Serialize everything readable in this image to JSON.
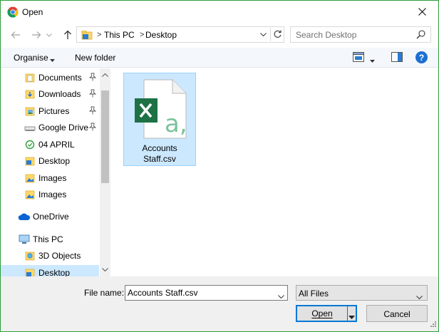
{
  "window": {
    "title": "Open",
    "app_icon": "chrome-icon",
    "close_icon": "close-icon"
  },
  "address": {
    "path": [
      "This PC",
      "Desktop"
    ],
    "separator": ">",
    "folder_icon": "folder-icon",
    "dropdown_icon": "chevron-down-icon",
    "refresh_icon": "refresh-icon"
  },
  "nav_buttons": {
    "back": "back-arrow-icon",
    "forward": "forward-arrow-icon",
    "recent": "chevron-down-icon",
    "up": "up-arrow-icon"
  },
  "search": {
    "placeholder": "Search Desktop",
    "icon": "search-icon"
  },
  "toolbar": {
    "organise_label": "Organise",
    "new_folder_label": "New folder",
    "help_label": "?"
  },
  "nav_pane": {
    "items": [
      {
        "label": "Documents",
        "icon": "documents-folder-icon",
        "pinned": true
      },
      {
        "label": "Downloads",
        "icon": "downloads-folder-icon",
        "pinned": true
      },
      {
        "label": "Pictures",
        "icon": "pictures-folder-icon",
        "pinned": true
      },
      {
        "label": "Google Drive",
        "icon": "drive-icon",
        "pinned": true
      },
      {
        "label": "04 APRIL",
        "icon": "sync-folder-icon",
        "pinned": false
      },
      {
        "label": "Desktop",
        "icon": "desktop-folder-icon",
        "pinned": false
      },
      {
        "label": "Images",
        "icon": "images-folder-icon",
        "pinned": false
      },
      {
        "label": "Images",
        "icon": "images-folder-icon",
        "pinned": false
      },
      {
        "label": "OneDrive",
        "icon": "onedrive-icon",
        "pinned": false
      },
      {
        "label": "This PC",
        "icon": "computer-icon",
        "pinned": false
      },
      {
        "label": "3D Objects",
        "icon": "3d-objects-folder-icon",
        "pinned": false
      },
      {
        "label": "Desktop",
        "icon": "desktop-folder-icon",
        "pinned": false,
        "selected": true
      }
    ]
  },
  "files": [
    {
      "name": "Accounts Staff.csv",
      "name_line1": "Accounts",
      "name_line2": "Staff.csv",
      "icon": "excel-csv-icon",
      "selected": true
    }
  ],
  "footer": {
    "file_name_label": "File name:",
    "file_name_value": "Accounts Staff.csv",
    "file_type": "All Files",
    "open_label": "Open",
    "cancel_label": "Cancel"
  },
  "colors": {
    "window_border": "#2e9e3a",
    "selection_bg": "#cce8ff",
    "selection_border": "#99d1ff",
    "accent": "#0078d7",
    "excel_green": "#1e7145",
    "csv_letter": "#7bc29a"
  }
}
